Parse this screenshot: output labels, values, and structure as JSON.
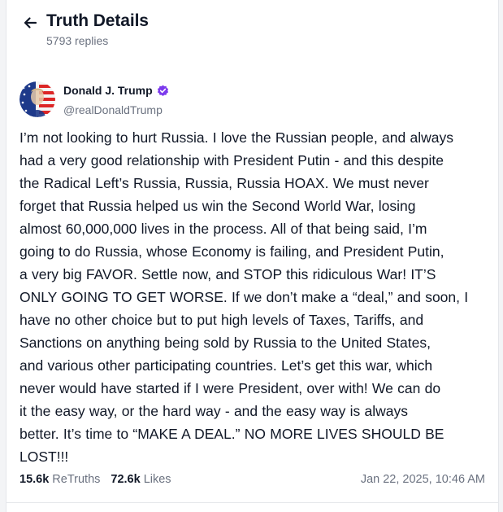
{
  "header": {
    "back_icon": "arrow-left-icon",
    "title": "Truth Details",
    "replies": "5793 replies"
  },
  "post": {
    "author": {
      "name": "Donald J. Trump",
      "handle": "@realDonaldTrump",
      "verified_icon": "verified-badge-icon",
      "verified_color": "#7c3aed"
    },
    "lines": [
      "I’m not looking to hurt Russia. I love the Russian people, and always",
      "had a very good relationship with President Putin - and this despite",
      "the Radical Left’s Russia, Russia, Russia HOAX. We must never",
      "forget that Russia helped us win the Second World War, losing",
      "almost 60,000,000 lives in the process. All of that being said, I’m",
      "going to do Russia, whose Economy is failing, and President Putin,",
      "a very big FAVOR. Settle now, and STOP this ridiculous War! IT’S",
      "ONLY GOING TO GET WORSE. If we don’t make a “deal,” and soon, I",
      "have no other choice but to put high levels of Taxes, Tariffs, and",
      "Sanctions on anything being sold by Russia to the United States,",
      "and various other participating countries. Let’s get this war, which",
      "never would have started if I were President, over with! We can do",
      "it the easy way, or the hard way - and the easy way is always",
      "better. It’s time to “MAKE A DEAL.” NO MORE LIVES SHOULD BE",
      "LOST!!!"
    ],
    "stats": {
      "retruths_count": "15.6k",
      "retruths_label": "ReTruths",
      "likes_count": "72.6k",
      "likes_label": "Likes"
    },
    "timestamp": "Jan 22, 2025, 10:46 AM"
  }
}
